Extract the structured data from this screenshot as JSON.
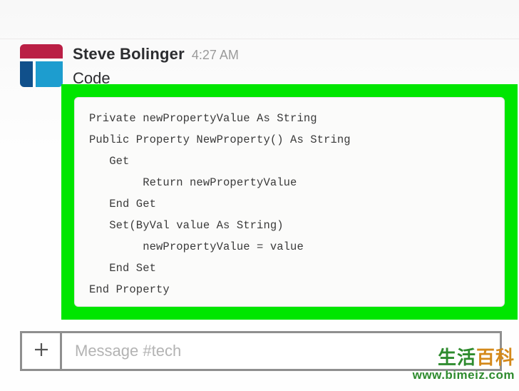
{
  "message": {
    "username": "Steve Bolinger",
    "timestamp": "4:27 AM",
    "text": "Code",
    "code": "Private newPropertyValue As String\nPublic Property NewProperty() As String\n   Get\n        Return newPropertyValue\n   End Get\n   Set(ByVal value As String)\n        newPropertyValue = value\n   End Set\nEnd Property"
  },
  "composer": {
    "placeholder": "Message #tech"
  },
  "watermark": {
    "line1_a": "生活",
    "line1_b": "百科",
    "line2": "www.bimeiz.com"
  }
}
